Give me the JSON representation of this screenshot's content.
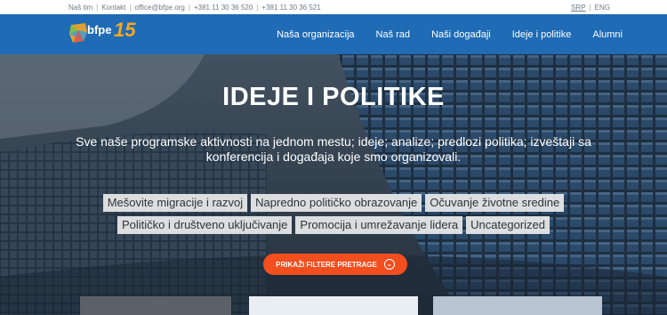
{
  "topbar": {
    "links": [
      "Naš tim",
      "Kontakt",
      "office@bfpe.org",
      "+381 11 30 36 520",
      "+381 11 30 36 521"
    ],
    "languages": [
      "SRP",
      "ENG"
    ]
  },
  "logo": {
    "text": "bfpe",
    "number": "15"
  },
  "nav": [
    "Naša organizacija",
    "Naš rad",
    "Naši događaji",
    "Ideje i politike",
    "Alumni"
  ],
  "hero": {
    "title": "IDEJE I POLITIKE",
    "subtitle": "Sve naše programske aktivnosti na jednom mestu; ideje; analize; predlozi politika; izveštaji sa konferencija i događaja koje smo organizovali."
  },
  "tags": [
    "Mešovite migracije i razvoj",
    "Napredno političko obrazovanje",
    "Očuvanje životne sredine",
    "Političko i društveno uključivanje",
    "Promocija i umrežavanje lidera",
    "Uncategorized"
  ],
  "filter_button": {
    "label": "PRIKAŽI FILTERE PRETRAGE",
    "icon": "chevron-down-icon"
  },
  "colors": {
    "nav_bg": "#1f6bb5",
    "accent": "#f24e1e",
    "logo_number": "#f6a623"
  }
}
